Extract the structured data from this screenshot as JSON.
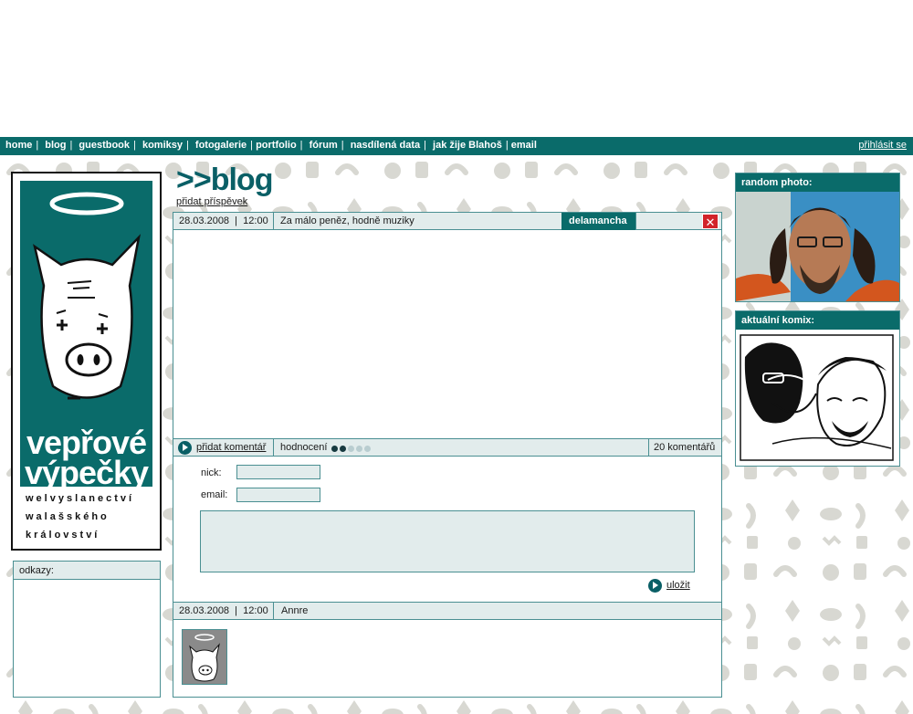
{
  "nav": {
    "items": [
      "home",
      "blog",
      "guestbook",
      "komiksy",
      "fotogalerie",
      "portfolio",
      "fórum",
      "nasdílená data",
      "jak žije Blahoš",
      "email"
    ],
    "login": "přihlásit se"
  },
  "logo": {
    "line1": "vepřové",
    "line2": "výpečky",
    "sub1": "welvyslanectví",
    "sub2": "walašského",
    "sub3": "království"
  },
  "links": {
    "header": "odkazy:"
  },
  "blog": {
    "title": ">>blog",
    "add_post": "přidat příspěvek",
    "post": {
      "date": "28.03.2008",
      "time": "12:00",
      "subject": "Za málo peněz, hodně muziky",
      "author": "delamancha",
      "close": "✕"
    },
    "footer": {
      "add_comment": "přidat komentář",
      "rating_label": "hodnocení",
      "rating": 2,
      "rating_max": 5,
      "comments": "20 komentářů"
    },
    "form": {
      "nick_label": "nick:",
      "email_label": "email:",
      "save": "uložit"
    },
    "comment": {
      "date": "28.03.2008",
      "time": "12:00",
      "author": "Annre"
    }
  },
  "sidebar": {
    "random_photo": "random photo:",
    "current_comic": "aktuální komix:"
  },
  "colors": {
    "teal": "#0a6b6a",
    "light": "#e2ecec",
    "border": "#4a8f92",
    "close": "#d2232a"
  }
}
